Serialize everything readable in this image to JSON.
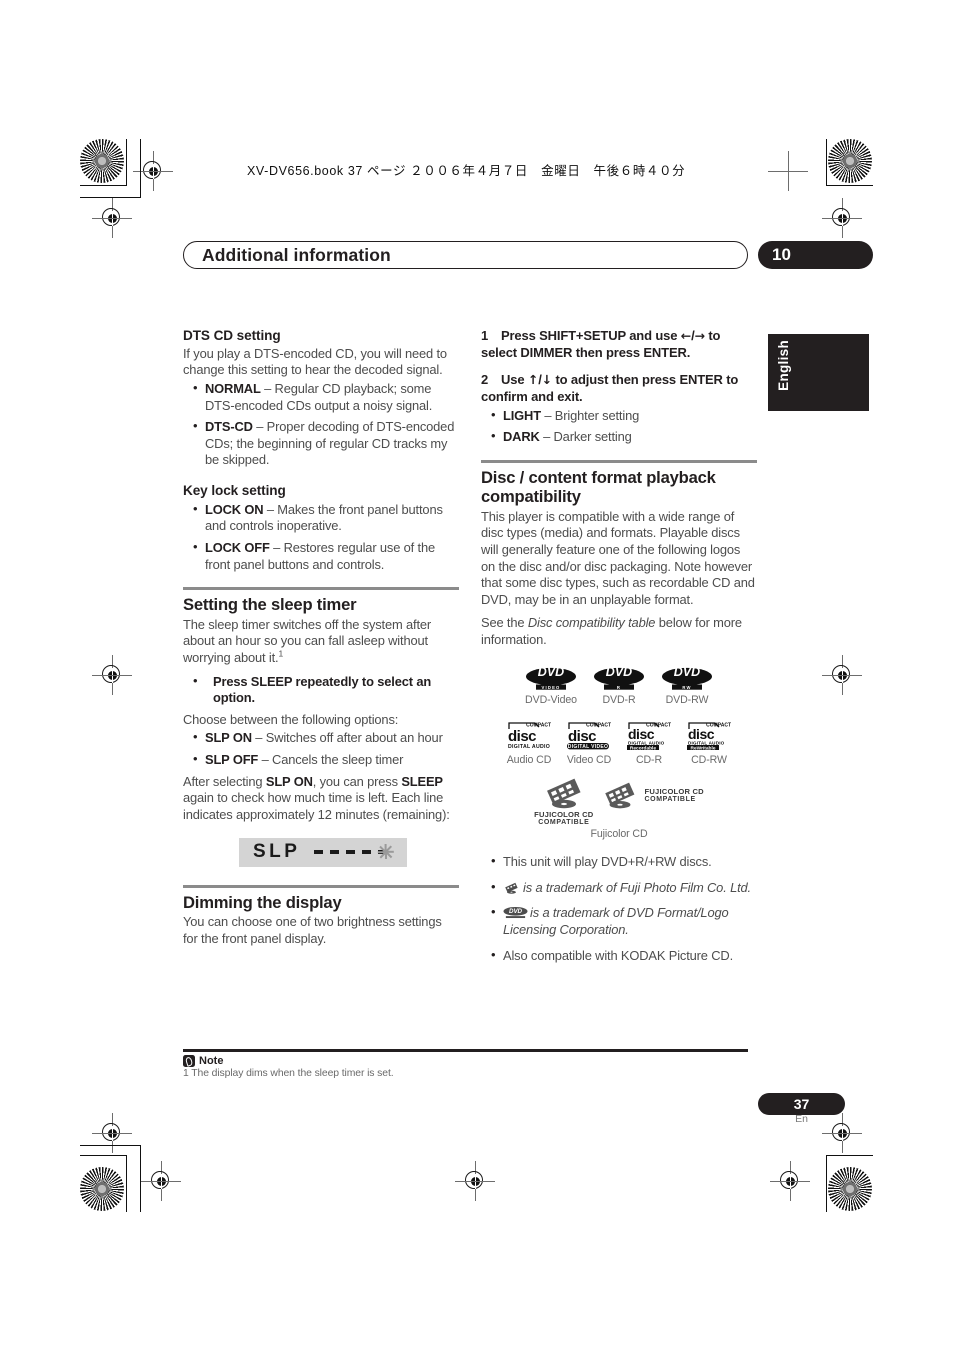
{
  "print_slug": "XV-DV656.book  37 ページ  ２００６年４月７日　金曜日　午後６時４０分",
  "header": {
    "chapter_title": "Additional information",
    "chapter_number": "10"
  },
  "language_tab": "English",
  "left_column": {
    "section_dts": {
      "heading": "DTS CD setting",
      "intro": "If you play a DTS-encoded CD, you will need to change this setting to hear the decoded signal.",
      "bullets": [
        {
          "term": "NORMAL",
          "text": " – Regular CD playback; some DTS-encoded CDs output a noisy signal."
        },
        {
          "term": "DTS-CD",
          "text": " – Proper decoding of DTS-encoded CDs; the beginning of regular CD tracks my be skipped."
        }
      ]
    },
    "section_keylock": {
      "heading": "Key lock setting",
      "bullets": [
        {
          "term": "LOCK ON",
          "text": " – Makes the front panel buttons and controls inoperative."
        },
        {
          "term": "LOCK OFF",
          "text": " – Restores regular use of the front panel buttons and controls."
        }
      ]
    },
    "section_sleep": {
      "heading": "Setting the sleep timer",
      "intro": "The sleep timer switches off the system after about an hour so you can fall asleep without worrying about it.",
      "intro_footnote": "1",
      "instruction": "Press SLEEP repeatedly to select an option.",
      "choose_line": "Choose between the following options:",
      "bullets": [
        {
          "term": "SLP ON",
          "text": " – Switches off after about an hour"
        },
        {
          "term": "SLP OFF",
          "text": " – Cancels the sleep timer"
        }
      ],
      "after_text_1": "After selecting ",
      "after_bold_1": "SLP ON",
      "after_text_2": ", you can press ",
      "after_bold_2": "SLEEP",
      "after_text_3": " again to check how much time is left. Each line indicates approximately 12 minutes (remaining):",
      "display_graphic": {
        "label": "SLP",
        "dash_count": 4,
        "blinking_dash": true
      }
    },
    "section_dimming": {
      "heading": "Dimming the display",
      "intro": "You can choose one of two brightness settings for the front panel display."
    }
  },
  "right_column": {
    "steps": [
      {
        "number": "1",
        "part1": "Press SHIFT+SETUP and use ",
        "arrow1": "←",
        "slash": "/",
        "arrow2": "→",
        "part2": " to select DIMMER then press ENTER."
      },
      {
        "number": "2",
        "part1": "Use ",
        "arrow1": "↑",
        "slash": "/",
        "arrow2": "↓",
        "part2": " to adjust then press ENTER to confirm and exit."
      }
    ],
    "step_bullets": [
      {
        "term": "LIGHT",
        "text": " – Brighter setting"
      },
      {
        "term": "DARK",
        "text": " – Darker setting"
      }
    ],
    "section_compat": {
      "heading_line1": "Disc / content format playback",
      "heading_line2": "compatibility",
      "para1": "This player is compatible with a wide range of disc types (media) and formats. Playable discs will generally feature one of the following logos on the disc and/or disc packaging. Note however that some disc types, such as recordable CD and DVD, may be in an unplayable format.",
      "para2_pre": "See the ",
      "para2_em": "Disc compatibility table",
      "para2_post": " below for more information."
    },
    "logos": {
      "dvd_row": [
        {
          "mark": "DVD",
          "sub": "VIDEO",
          "caption": "DVD-Video"
        },
        {
          "mark": "DVD",
          "sub": "R",
          "caption": "DVD-R"
        },
        {
          "mark": "DVD",
          "sub": "RW",
          "caption": "DVD-RW"
        }
      ],
      "cd_row": [
        {
          "top": "COMPACT",
          "mark": "disc",
          "sub": "DIGITAL AUDIO",
          "boxed": false,
          "caption": "Audio CD"
        },
        {
          "top": "COMPACT",
          "mark": "disc",
          "sub": "DIGITAL VIDEO",
          "boxed": true,
          "caption": "Video CD"
        },
        {
          "top": "COMPACT",
          "mark": "disc",
          "sub2": "DIGITAL AUDIO",
          "sub": "Recordable",
          "boxed": true,
          "caption": "CD-R"
        },
        {
          "top": "COMPACT",
          "mark": "disc",
          "sub2": "DIGITAL AUDIO",
          "sub": "ReWritable",
          "boxed": true,
          "caption": "CD-RW"
        }
      ],
      "fuji": {
        "line1": "FUJICOLOR CD",
        "line2": "COMPATIBLE",
        "caption": "Fujicolor CD"
      }
    },
    "compat_bullets": [
      {
        "text": "This unit will play DVD+R/+RW discs."
      },
      {
        "icon": "fujicolor-film-icon",
        "em": "is a trademark of Fuji Photo Film Co. Ltd."
      },
      {
        "icon": "dvd-logo-icon",
        "em": "is a trademark of DVD Format/Logo Licensing Corporation."
      },
      {
        "text": "Also compatible with KODAK Picture CD."
      }
    ]
  },
  "footer": {
    "note_label": "Note",
    "note_text": "1 The display dims when the sleep timer is set.",
    "page_number": "37",
    "page_lang": "En"
  }
}
